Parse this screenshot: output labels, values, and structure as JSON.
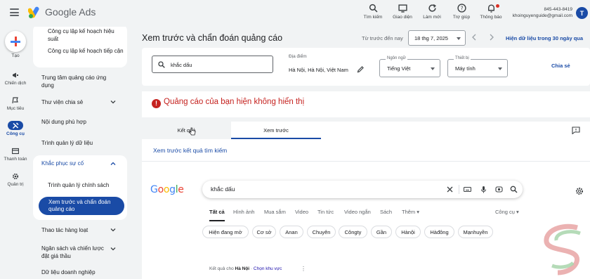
{
  "app": {
    "name": "Google Ads"
  },
  "topbar": {
    "icons": [
      {
        "icon": "search-icon",
        "label": "Tìm kiếm"
      },
      {
        "icon": "appearance-icon",
        "label": "Giao diện"
      },
      {
        "icon": "refresh-icon",
        "label": "Làm mới"
      },
      {
        "icon": "help-icon",
        "label": "Trợ giúp"
      },
      {
        "icon": "bell-icon",
        "label": "Thông báo"
      }
    ],
    "account_id": "845-443-8419",
    "account_email": "khoinguyenguide@gmail.com",
    "avatar_letter": "T"
  },
  "rail": {
    "create_label": "Tạo",
    "items": [
      {
        "icon": "campaign-icon",
        "label": "Chiến dịch"
      },
      {
        "icon": "goal-icon",
        "label": "Mục tiêu"
      },
      {
        "icon": "tools-icon",
        "label": "Công cụ"
      },
      {
        "icon": "billing-icon",
        "label": "Thanh toán"
      },
      {
        "icon": "admin-icon",
        "label": "Quản trị"
      }
    ]
  },
  "nav": {
    "planner_items": [
      "Công cụ lập kế hoạch hiệu suất",
      "Công cụ lập kế hoạch tiếp cận"
    ],
    "app_center": "Trung tâm quảng cáo ứng dụng",
    "shared_library": "Thư viện chia sẻ",
    "fit_content": "Nội dung phù hợp",
    "data_manager": "Trình quản lý dữ liệu",
    "troubleshoot": "Khắc phục sự cố",
    "policy_manager": "Trình quản lý chính sách",
    "preview_diag": "Xem trước và chẩn đoán quảng cáo",
    "bulk_actions": "Thao tác hàng loạt",
    "budget_strategy": "Ngân sách và chiến lược đặt giá thầu",
    "business_data": "Dữ liệu doanh nghiệp"
  },
  "main": {
    "title": "Xem trước và chẩn đoán quảng cáo",
    "range_label": "Từ trước đến nay",
    "date": "18 thg 7, 2025",
    "live_data_link": "Hiện dữ liệu trong 30 ngày qua",
    "search_query": "khắc dấu",
    "location_label": "Địa điểm",
    "location_value": "Hà Nội, Hà Nội, Việt Nam",
    "language_label": "Ngôn ngữ",
    "language_value": "Tiếng Việt",
    "device_label": "Thiết bị",
    "device_value": "Máy tính",
    "share_label": "Chia sẻ",
    "alert": "Quảng cáo của bạn hiện không hiển thị",
    "tab_results": "Kết quả",
    "tab_preview": "Xem trước",
    "preview_link": "Xem trước kết quả tìm kiếm"
  },
  "serp": {
    "query": "khắc dấu",
    "tabs": [
      "Tất cả",
      "Hình ảnh",
      "Mua sắm",
      "Video",
      "Tin tức",
      "Video ngắn",
      "Sách",
      "Thêm ▾"
    ],
    "tools": "Công cụ ▾",
    "chips": [
      "Hiện đang mở",
      "Cơ sở",
      "Anan",
      "Chuyên",
      "Côngty",
      "Gần",
      "Hànội",
      "Hàđông",
      "Mạnhuyền"
    ],
    "result_prefix": "Kết quả cho",
    "result_place": "Hà Nội",
    "result_change": "Chọn khu vực"
  },
  "colors": {
    "accent": "#1a4ba6",
    "alert": "#c5221f",
    "background": "#f1f3f4"
  }
}
